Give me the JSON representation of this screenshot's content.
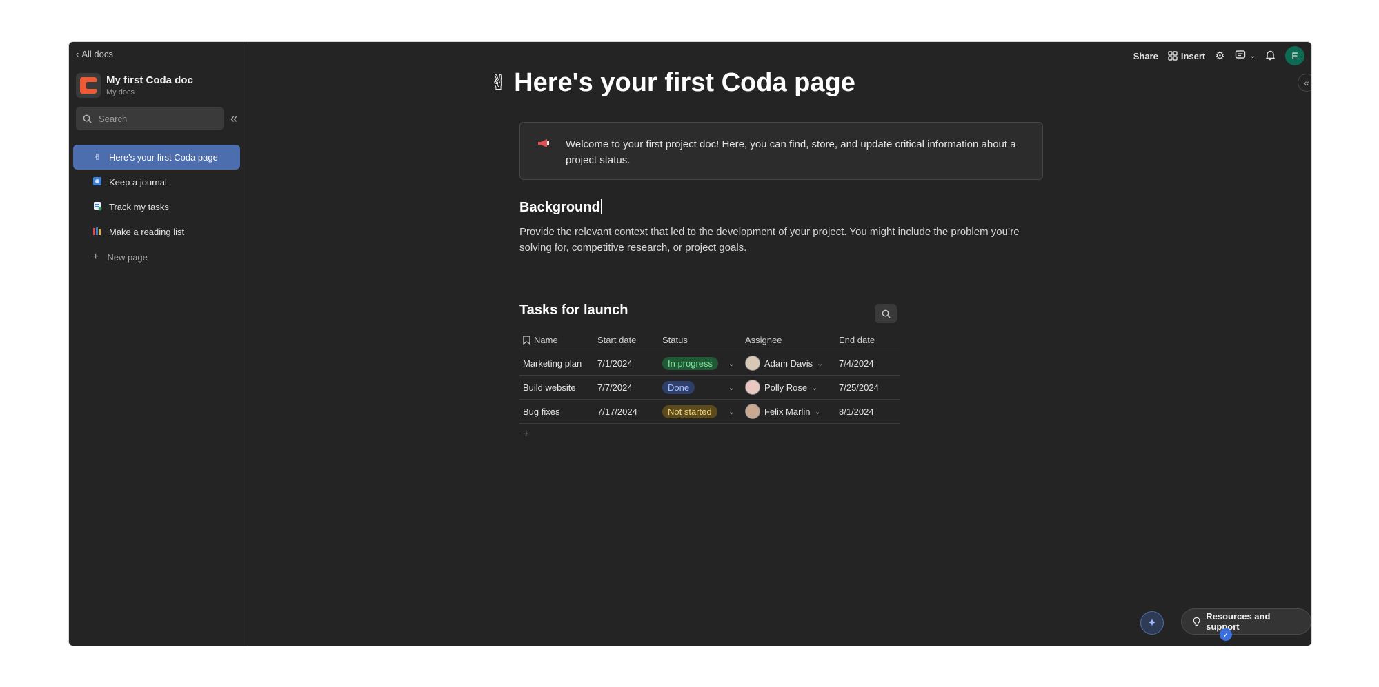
{
  "sidebar": {
    "back_label": "All docs",
    "doc_title": "My first Coda doc",
    "doc_subtitle": "My docs",
    "search_placeholder": "Search",
    "items": [
      {
        "label": "Here's your first Coda page",
        "icon": "✌️",
        "active": true
      },
      {
        "label": "Keep a journal",
        "icon": "journal-icon"
      },
      {
        "label": "Track my tasks",
        "icon": "document-icon"
      },
      {
        "label": "Make a reading list",
        "icon": "books-icon"
      }
    ],
    "new_page_label": "New page"
  },
  "topbar": {
    "share_label": "Share",
    "insert_label": "Insert",
    "avatar_initial": "E"
  },
  "page": {
    "emoji": "✌️",
    "title": "Here's your first Coda page",
    "callout": "Welcome to your first project doc! Here, you can find, store, and update critical information about a project status.",
    "background_heading": "Background",
    "background_text": "Provide the relevant context that led to the development of your project. You might include the problem you’re solving for, competitive research, or project goals."
  },
  "tasks": {
    "heading": "Tasks for launch",
    "columns": [
      "Name",
      "Start date",
      "Status",
      "Assignee",
      "End date"
    ],
    "rows": [
      {
        "name": "Marketing plan",
        "start": "7/1/2024",
        "status": "In progress",
        "status_color": "#1f5a35",
        "status_text_color": "#7ee29a",
        "assignee": "Adam Davis",
        "end": "7/4/2024"
      },
      {
        "name": "Build website",
        "start": "7/7/2024",
        "status": "Done",
        "status_color": "#2e3f6b",
        "status_text_color": "#a9c2ff",
        "assignee": "Polly Rose",
        "end": "7/25/2024"
      },
      {
        "name": "Bug fixes",
        "start": "7/17/2024",
        "status": "Not started",
        "status_color": "#5a4a1c",
        "status_text_color": "#f0d27a",
        "assignee": "Felix Marlin",
        "end": "8/1/2024"
      }
    ]
  },
  "footer": {
    "resources_label": "Resources and support"
  }
}
